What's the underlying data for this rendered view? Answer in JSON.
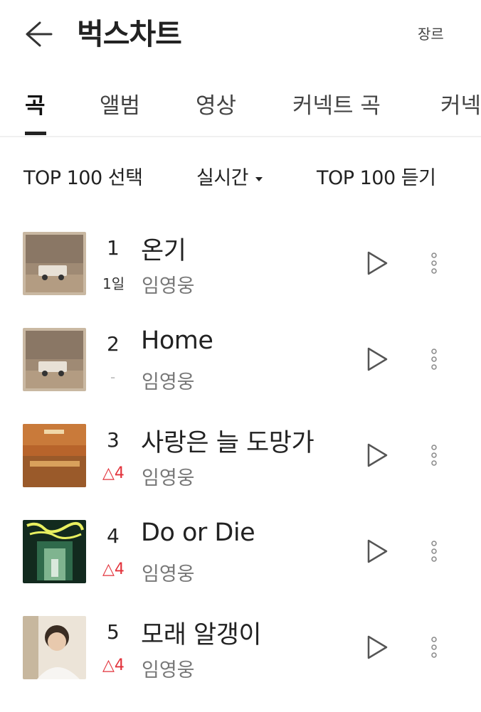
{
  "header": {
    "title": "벅스차트",
    "genre_label": "장르"
  },
  "tabs": [
    {
      "label": "곡",
      "active": true
    },
    {
      "label": "앨범"
    },
    {
      "label": "영상"
    },
    {
      "label": "커넥트 곡"
    },
    {
      "label": "커넥"
    }
  ],
  "filters": {
    "top100_select": "TOP 100 선택",
    "period": "실시간",
    "top100_listen": "TOP 100 듣기"
  },
  "colors": {
    "accent_up": "#e2313a"
  },
  "chart": [
    {
      "rank": "1",
      "change": "1일",
      "change_type": "days",
      "title": "온기",
      "artist": "임영웅"
    },
    {
      "rank": "2",
      "change": "-",
      "change_type": "same",
      "title": "Home",
      "artist": "임영웅"
    },
    {
      "rank": "3",
      "change": "△4",
      "change_type": "up",
      "title": "사랑은 늘 도망가",
      "artist": "임영웅"
    },
    {
      "rank": "4",
      "change": "△4",
      "change_type": "up",
      "title": "Do or Die",
      "artist": "임영웅"
    },
    {
      "rank": "5",
      "change": "△4",
      "change_type": "up",
      "title": "모래 알갱이",
      "artist": "임영웅"
    }
  ]
}
